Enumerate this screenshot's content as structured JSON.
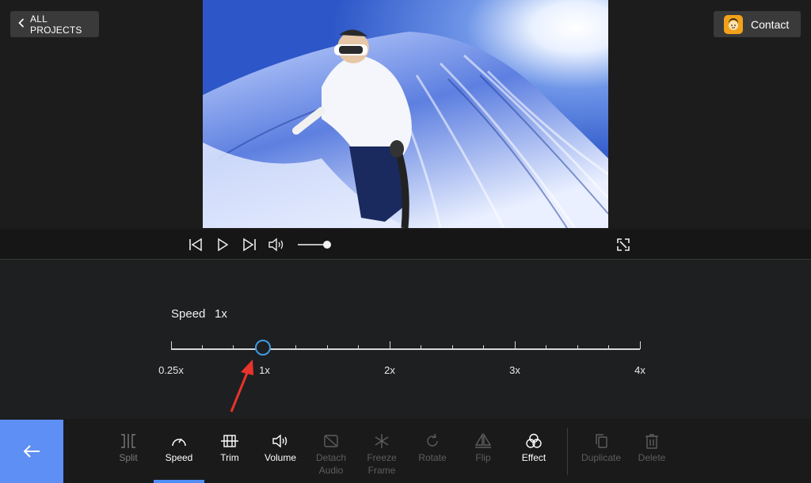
{
  "header": {
    "back_label": "ALL PROJECTS",
    "contact_label": "Contact"
  },
  "speed": {
    "label": "Speed",
    "value_label": "1x",
    "current": 1,
    "ticks": [
      "0.25x",
      "1x",
      "2x",
      "3x",
      "4x"
    ]
  },
  "player": {
    "volume_fraction": 0.9
  },
  "toolbar": {
    "tools": [
      {
        "label": "Split",
        "icon": "split-icon",
        "state": "dim"
      },
      {
        "label": "Speed",
        "icon": "speed-icon",
        "state": "active"
      },
      {
        "label": "Trim",
        "icon": "trim-icon",
        "state": "active"
      },
      {
        "label": "Volume",
        "icon": "volume-icon",
        "state": "active"
      },
      {
        "label": "Detach\nAudio",
        "icon": "detach-audio-icon",
        "state": "dimmer"
      },
      {
        "label": "Freeze\nFrame",
        "icon": "freeze-frame-icon",
        "state": "dimmer"
      },
      {
        "label": "Rotate",
        "icon": "rotate-icon",
        "state": "dimmer"
      },
      {
        "label": "Flip",
        "icon": "flip-icon",
        "state": "dimmer"
      },
      {
        "label": "Effect",
        "icon": "effect-icon",
        "state": "active"
      },
      {
        "label": "Duplicate",
        "icon": "duplicate-icon",
        "state": "dimmer"
      },
      {
        "label": "Delete",
        "icon": "delete-icon",
        "state": "dimmer"
      }
    ]
  },
  "colors": {
    "accent": "#5d8ff4",
    "slider_thumb": "#3d9be0",
    "annotation_arrow": "#e8342a"
  }
}
